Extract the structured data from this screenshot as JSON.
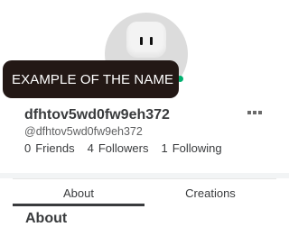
{
  "tooltip": {
    "text": "EXAMPLE OF THE NAME"
  },
  "profile": {
    "display_name": "dfhtov5wd0fw9eh372",
    "handle": "@dfhtov5wd0fw9eh372",
    "friends_count": "0",
    "friends_label": "Friends",
    "followers_count": "4",
    "followers_label": "Followers",
    "following_count": "1",
    "following_label": "Following"
  },
  "tabs": [
    {
      "label": "About",
      "active": true
    },
    {
      "label": "Creations",
      "active": false
    }
  ],
  "section": {
    "title": "About"
  },
  "icons": {
    "more": "more-options-icon",
    "status": "online-status-icon"
  },
  "colors": {
    "tooltip_bg": "#231815",
    "text": "#393b3d",
    "status_online": "#00b06f"
  }
}
